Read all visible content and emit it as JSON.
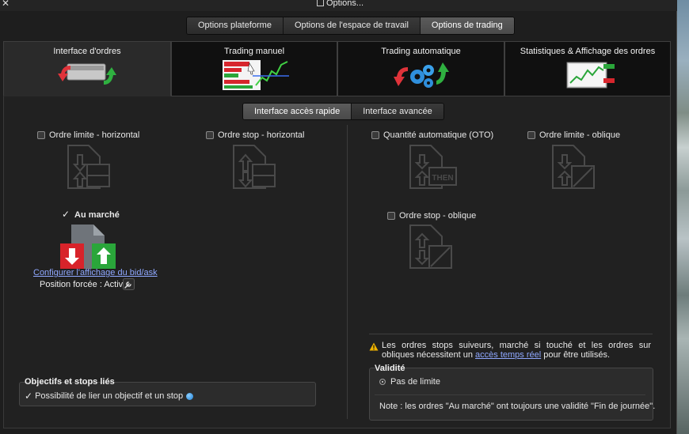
{
  "window": {
    "title": "Options..."
  },
  "top_tabs": [
    {
      "label": "Options plateforme",
      "active": false
    },
    {
      "label": "Options de l'espace de travail",
      "active": false
    },
    {
      "label": "Options de trading",
      "active": true
    }
  ],
  "main_tabs": [
    {
      "label": "Interface d'ordres",
      "icon": "order-interface-icon",
      "active": true
    },
    {
      "label": "Trading manuel",
      "icon": "manual-trading-icon",
      "active": false
    },
    {
      "label": "Trading automatique",
      "icon": "automatic-trading-icon",
      "active": false
    },
    {
      "label": "Statistiques & Affichage des ordres",
      "icon": "statistics-chart-icon",
      "active": false
    }
  ],
  "sub_tabs": [
    {
      "label": "Interface accès rapide",
      "active": true
    },
    {
      "label": "Interface avancée",
      "active": false
    }
  ],
  "left_panel": {
    "limit_horizontal": {
      "label": "Ordre limite - horizontal",
      "checked": false
    },
    "stop_horizontal": {
      "label": "Ordre stop - horizontal",
      "checked": false
    },
    "market": {
      "label": "Au marché",
      "checked": true
    },
    "bidask_link": "Configurer l'affichage du bid/ask",
    "forced_position": "Position forcée : Activé"
  },
  "right_panel": {
    "auto_quantity": {
      "label": "Quantité automatique (OTO)",
      "checked": false
    },
    "then_label": "THEN",
    "limit_oblique": {
      "label": "Ordre limite - oblique",
      "checked": false
    },
    "stop_oblique": {
      "label": "Ordre stop - oblique",
      "checked": false
    }
  },
  "objectives": {
    "title": "Objectifs et stops liés",
    "option": "Possibilité de lier un objectif et un stop",
    "checked": true
  },
  "warning": {
    "text_before": "Les ordres stops suiveurs, marché si touché et les ordres sur obliques nécessitent un ",
    "link": "accès temps réel",
    "text_after": " pour être utilisés."
  },
  "validity": {
    "title": "Validité",
    "option": "Pas de limite",
    "note": "Note : les ordres \"Au marché\" ont toujours une validité \"Fin de journée\"."
  },
  "colors": {
    "accent_link": "#8fa8ff",
    "arrow_red": "#d8232a",
    "arrow_green": "#2aa63a",
    "warning": "#f0b400"
  }
}
